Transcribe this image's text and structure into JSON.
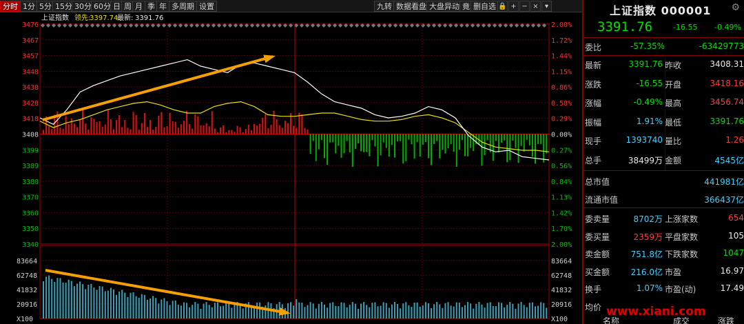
{
  "toolbar": {
    "left": [
      "分时",
      "1分",
      "5分",
      "15分",
      "30分",
      "60分",
      "日",
      "周",
      "月",
      "季",
      "年",
      "多周期",
      "设置"
    ],
    "right": [
      "九转",
      "数据看盘",
      "大盘异动",
      "竟",
      "删自选"
    ]
  },
  "chart": {
    "header": {
      "name": "上证指数",
      "lead_label": "领先:",
      "lead_value": "3397.74",
      "last_label": "最新:",
      "last_value": "3391.76"
    },
    "price_ticks": [
      "3476",
      "3467",
      "3457",
      "3448",
      "3438",
      "3428",
      "3418",
      "3408",
      "3399",
      "3389",
      "3380",
      "3370",
      "3360",
      "3350",
      "3340"
    ],
    "pct_ticks": [
      "2.00%",
      "1.72%",
      "1.44%",
      "1.15%",
      "0.86%",
      "0.58%",
      "0.29%",
      "0.00%",
      "0.27%",
      "0.56%",
      "0.84%",
      "1.13%",
      "1.42%",
      "1.70%",
      "2.00%"
    ],
    "vol_ticks_left": [
      "83664",
      "62748",
      "41832",
      "20916",
      "X100"
    ],
    "vol_ticks_right": [
      "83664",
      "62748",
      "41832",
      "20916",
      "X100"
    ],
    "colors": {
      "up": "#ff3030",
      "down": "#00c000",
      "price_line": "#ffffff",
      "avg_line": "#e8e000",
      "axis_red": "#a00000",
      "arrow": "#f5a000",
      "vol_bar": "#3aa0b8"
    }
  },
  "chart_data": {
    "type": "line",
    "series": [
      {
        "values": [
          3418,
          3414,
          3423,
          3434,
          3438,
          3441,
          3444,
          3446,
          3448,
          3450,
          3452,
          3454,
          3450,
          3448,
          3446,
          3451,
          3452,
          3450,
          3448,
          3446,
          3440,
          3433,
          3428,
          3426,
          3424,
          3420,
          3418,
          3419,
          3421,
          3425,
          3423,
          3418,
          3407,
          3400,
          3397,
          3398,
          3394,
          3393,
          3392
        ]
      },
      {
        "values": [
          3416,
          3412,
          3415,
          3417,
          3420,
          3423,
          3425,
          3427,
          3428,
          3426,
          3423,
          3421,
          3421,
          3425,
          3427,
          3428,
          3425,
          3420,
          3419,
          3419,
          3420,
          3421,
          3421,
          3419,
          3417,
          3416,
          3416,
          3417,
          3419,
          3420,
          3418,
          3415,
          3409,
          3403,
          3400,
          3399,
          3398,
          3398,
          3397
        ]
      }
    ],
    "ylim": [
      3340,
      3476
    ]
  },
  "panel": {
    "title": "上证指数 000001",
    "price": "3391.76",
    "change": "-16.55",
    "change_pct": "-0.49%",
    "weibi": {
      "label": "委比",
      "pct": "-57.35%",
      "diff": "-63429773"
    },
    "rows_a": [
      {
        "l1": "最新",
        "v1": "3391.76",
        "c1": "g",
        "l2": "昨收",
        "v2": "3408.31",
        "c2": "w"
      },
      {
        "l1": "涨跌",
        "v1": "-16.55",
        "c1": "g",
        "l2": "开盘",
        "v2": "3418.16",
        "c2": "r"
      },
      {
        "l1": "涨幅",
        "v1": "-0.49%",
        "c1": "g",
        "l2": "最高",
        "v2": "3456.74",
        "c2": "r"
      },
      {
        "l1": "振幅",
        "v1": "1.91%",
        "c1": "c",
        "l2": "最低",
        "v2": "3391.76",
        "c2": "g"
      },
      {
        "l1": "现手",
        "v1": "1393740",
        "c1": "c",
        "l2": "量比",
        "v2": "1.26",
        "c2": "r"
      },
      {
        "l1": "总手",
        "v1": "38499万",
        "c1": "w",
        "l2": "金额",
        "v2": "4545亿",
        "c2": "c"
      }
    ],
    "rows_b": [
      {
        "l1": "总市值",
        "v": "441981亿",
        "c": "c"
      },
      {
        "l1": "流通市值",
        "v": "366437亿",
        "c": "c"
      }
    ],
    "rows_c": [
      {
        "l1": "委卖量",
        "v1": "8702万",
        "c1": "c",
        "l2": "上涨家数",
        "v2": "654",
        "c2": "r"
      },
      {
        "l1": "委买量",
        "v1": "2359万",
        "c1": "r",
        "l2": "平盘家数",
        "v2": "105",
        "c2": "w"
      },
      {
        "l1": "卖金额",
        "v1": "751.8亿",
        "c1": "c",
        "l2": "下跌家数",
        "v2": "1047",
        "c2": "g"
      },
      {
        "l1": "买金额",
        "v1": "216.0亿",
        "c1": "c",
        "l2": "市盈",
        "v2": "16.97",
        "c2": "w"
      },
      {
        "l1": "换手",
        "v1": "1.07%",
        "c1": "c",
        "l2": "市盈(动)",
        "v2": "17.49",
        "c2": "w"
      },
      {
        "l1": "均价",
        "v1": "",
        "c1": "g",
        "l2": "",
        "v2": "",
        "c2": "w"
      }
    ],
    "footer": [
      "名称",
      "成交",
      "涨跌"
    ],
    "watermark": "www.xiani.com"
  }
}
